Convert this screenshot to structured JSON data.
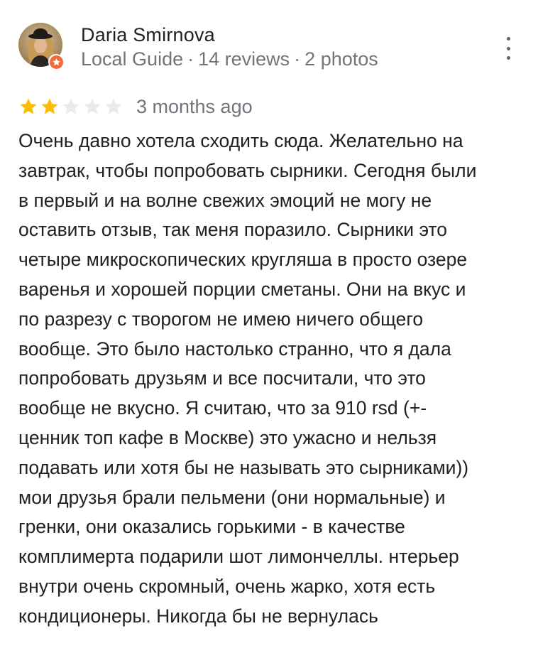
{
  "author": {
    "name": "Daria Smirnova",
    "role": "Local Guide",
    "reviews": "14 reviews",
    "photos": "2 photos",
    "separator": "·"
  },
  "rating": {
    "value": 2,
    "max": 5,
    "filled_color": "#fbbc04",
    "empty_color": "#e8eaed"
  },
  "review": {
    "time": "3 months ago",
    "text": "Очень давно хотела сходить сюда. Желательно на\nзавтрак, чтобы попробовать сырники. Сегодня были\nв первый и на волне свежих эмоций не могу не\nоставить отзыв, так меня поразило. Сырники это\nчетыре микроскопических кругляша в просто озере\nваренья и хорошей порции сметаны. Они на вкус и\nпо разрезу с творогом не имею ничего общего\nвообще. Это было настолько странно, что я дала\nпопробовать друзьям и все посчитали, что это\nвообще не вкусно. Я считаю, что за 910 rsd (+-\nценник топ кафе в Москве) это ужасно и нельзя\nподавать или хотя бы не называть это сырниками))\nмои друзья брали пельмени (они нормальные) и\nгренки, они оказались горькими - в качестве\nкомплимерта подарили шот лимончеллы. нтерьер\nвнутри очень скромный, очень жарко, хотя есть\nкондиционеры. Никогда бы не вернулась"
  },
  "icons": {
    "avatar": "user-photo-avatar",
    "badge": "local-guide-badge-icon",
    "more": "more-vert-icon",
    "star": "star-icon"
  },
  "colors": {
    "text_primary": "#202124",
    "text_secondary": "#70757a",
    "badge_orange": "#f2693a"
  }
}
